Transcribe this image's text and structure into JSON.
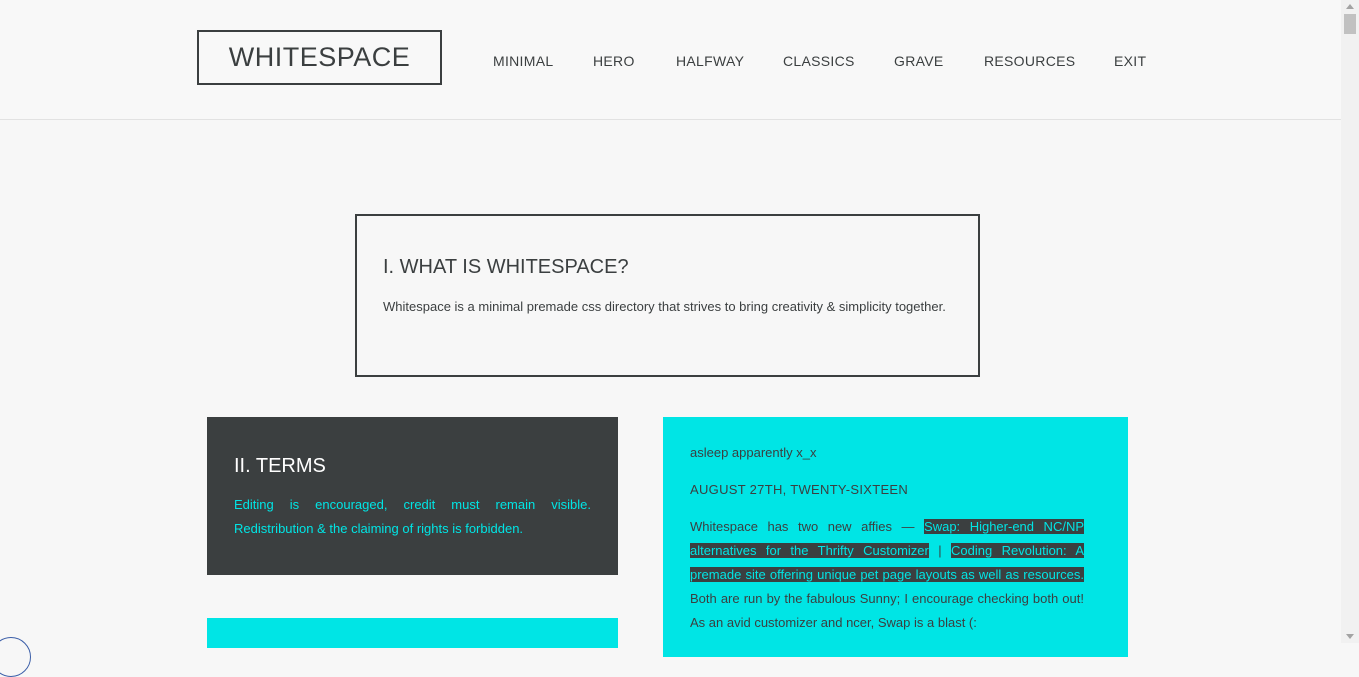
{
  "header": {
    "logo": "WHITESPACE",
    "nav": [
      "MINIMAL",
      "HERO",
      "HALFWAY",
      "CLASSICS",
      "GRAVE",
      "RESOURCES",
      "EXIT"
    ]
  },
  "what": {
    "title": "I. WHAT IS WHITESPACE?",
    "text": "Whitespace is a minimal premade css directory that strives to bring creativity & simplicity together."
  },
  "terms": {
    "title": "II. TERMS",
    "text": "Editing is encouraged, credit must remain visible. Redistribution & the claiming of rights is forbidden."
  },
  "update": {
    "status": "asleep apparently x_x",
    "date": "AUGUST 27TH, TWENTY-SIXTEEN",
    "intro": "Whitespace has two new affies — ",
    "link1": "Swap: Higher-end NC/NP alternatives for the Thrifty Customizer",
    "separator": " | ",
    "link2": "Coding Revolution: A premade site offering unique pet page layouts as well as resources.",
    "outro": " Both are run by the fabulous Sunny; I encourage checking both out! As an avid customizer and ncer, Swap is a blast (:"
  },
  "colors": {
    "dark": "#3b3f40",
    "cyan": "#00e5e5",
    "background": "#f7f7f7"
  }
}
